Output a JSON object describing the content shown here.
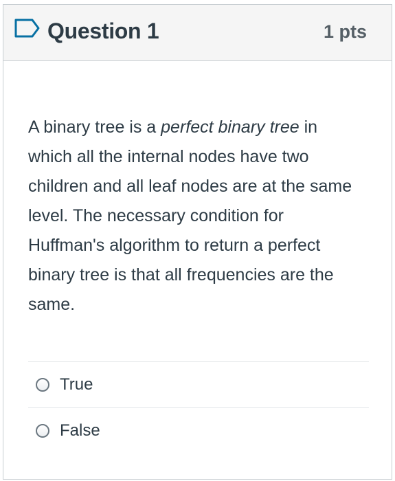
{
  "question": {
    "title": "Question 1",
    "points": "1 pts",
    "flag_icon": "flag-outline-icon",
    "text_before_em": "A binary tree is a ",
    "text_em": "perfect binary tree",
    "text_after_em": " in which all the internal nodes have two children and all leaf nodes are at the same level.  The necessary condition for Huffman's algorithm to return a perfect binary tree is that all frequencies are the same."
  },
  "answers": [
    {
      "label": "True",
      "selected": false
    },
    {
      "label": "False",
      "selected": false
    }
  ],
  "colors": {
    "text": "#2d3b45",
    "header_bg": "#f5f5f5",
    "border": "#c7cdd1",
    "flag": "#0770a3"
  }
}
